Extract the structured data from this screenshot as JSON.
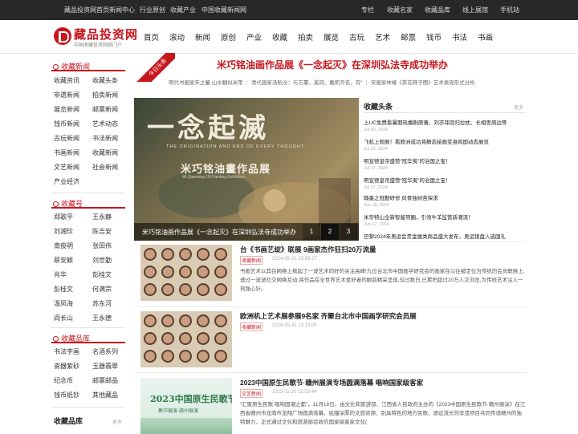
{
  "topbar": {
    "left_links": [
      "藏品投资网首页",
      "新闻中心",
      "行业原创",
      "收藏产业",
      "中国收藏新闻网"
    ],
    "right_links": [
      "专栏",
      "收藏名家",
      "收藏品库",
      "线上展馆",
      "手机站"
    ]
  },
  "logo": {
    "name": "藏品投资网",
    "tagline": "中国收藏投资网络门户"
  },
  "nav": [
    "首页",
    "滚动",
    "新闻",
    "原创",
    "产业",
    "收藏",
    "拍卖",
    "展览",
    "古玩",
    "艺术",
    "邮票",
    "钱币",
    "书法",
    "书画"
  ],
  "left": {
    "news": {
      "title": "收藏新闻",
      "items": [
        [
          "收藏资讯",
          "收藏头条"
        ],
        [
          "非遗新闻",
          "拍卖新闻"
        ],
        [
          "展览新闻",
          "邮票新闻"
        ],
        [
          "钱币新闻",
          "艺术动态"
        ],
        [
          "古玩新闻",
          "书法新闻"
        ],
        [
          "书画新闻",
          "收藏新闻"
        ],
        [
          "文艺新闻",
          "社会新闻"
        ],
        [
          "产业经济",
          ""
        ]
      ]
    },
    "accounts": {
      "title": "收藏号",
      "items": [
        [
          "郑歌平",
          "王永静"
        ],
        [
          "刘湘珍",
          "陈吉安"
        ],
        [
          "南俊明",
          "张田伟"
        ],
        [
          "蔡安颖",
          "刘世勤"
        ],
        [
          "肖华",
          "彭桂文"
        ],
        [
          "彭桂文",
          "何满宗"
        ],
        [
          "温凤海",
          "苏东河"
        ],
        [
          "阎长山",
          "王永德"
        ]
      ]
    },
    "library": {
      "title": "收藏品库",
      "items": [
        [
          "书法字画",
          "名酒系列"
        ],
        [
          "瓷器紫砂",
          "玉器翡翠"
        ],
        [
          "纪念币",
          "邮票邮品"
        ],
        [
          "钱币纸钞",
          "其他藏品"
        ]
      ]
    },
    "collect_lib": {
      "title": "收藏品库",
      "more": "更多"
    }
  },
  "headline": {
    "ribbon": "今日头条",
    "title": "米巧铭油画作品展《一念起灭》在深圳弘法寺成功举办",
    "subtitle": "明代书画家朱之蕃 山水翻似米芾 ｜ 清代画家汤贻汾：与方薰、奚冈、戴熙齐名，有“ ｜ 宋画家林椿《茶花蒔子图》艺术表现形式分析"
  },
  "hero": {
    "big_text": "一念起滅",
    "en_text": "THE ORIGINATION AND END OF EVERY THOUGHT",
    "exhibit_title": "米巧铭油畫作品展",
    "exhibit_en": "Mi Qiaoming Oil Painting Exhibition",
    "caption": "米巧铭油画作品展《一念起灭》在深圳弘法寺成功举办",
    "pages": [
      "1",
      "2",
      "3"
    ],
    "active_page": 1
  },
  "collect_headlines": {
    "title": "收藏头条",
    "more": "更多",
    "items": [
      {
        "title": "上UC免费看暑期热播剧原著，刘亦菲回归拉枕、长相思周边等",
        "date": "Jul 30, 2024"
      },
      {
        "title": "飞机上观展！看欧洲成功将静态绘画变身跨国动态展览",
        "date": "Jul 23, 2024"
      },
      {
        "title": "明宣德皇帝盛赞“冠华夷”的治国之宝！",
        "date": "Jul 17, 2024"
      },
      {
        "title": "明宣德皇帝盛赞“冠华夷”的治国之宝！",
        "date": "Jul 17, 2024"
      },
      {
        "title": "翰墨之冠勤研修 风骨独树苦探求",
        "date": "Jun 18, 2024"
      },
      {
        "title": "米帝特山全新智能项圈，引领牛羊监管新潮流！",
        "date": "Jun 17, 2024"
      },
      {
        "title": "巴黎2024年奥运会贵金属类商品盛大发布，奥运银盘入选国礼",
        "date": ""
      }
    ]
  },
  "articles": [
    {
      "title": "台《书画艺绽》联展 9画家杰作狂扫20万流量",
      "tag": "收藏新闻",
      "date": "2024-05-31 15:59:27",
      "body": "书画艺术以其在网络上掀起了一波艺术同好的关注高峰!九位台北市中国画学研究会的画家在以往被定位为传统的会员联展上,透过一波波社交网络互动,将作品在全世界艺术爱好者的眼前精采呈现,仅过数日,已累积超过20万人次浏览,为传统艺术注入一剂强心针。"
    },
    {
      "title": "欧洲机上艺术展参展9名家 齐聚台北市中国画学研究会员展",
      "tag": "收藏新闻",
      "date": "2024-05-31 13:19:05",
      "body": ""
    },
    {
      "title": "2023中国原生民歌节·赣州展演专场圆满落幕 唱响国家级客家",
      "tag": "文艺新闻",
      "date": "2023-11-20 15:53:44",
      "body": "“汇聚原生民歌 唱响国潮之都”，11月18日，由文化和旅游部、江西省人民政府主办的《2023中国原生民歌节·赣州展演》在江西省赣州市龙南市龙翔广场圆满落幕。底蕴深厚的文旅资源、别具特色的地方民歌、源远流长的非遗项目共同传递赣州的独特魅力，正式通过文化和旅游部验收的国家级客家文化(",
      "poster_title": "2023中国原生民歌节",
      "poster_sub": "集中展演·赣州展演"
    }
  ],
  "colors": {
    "brand": "#c8161d",
    "topbar": "#282828"
  }
}
